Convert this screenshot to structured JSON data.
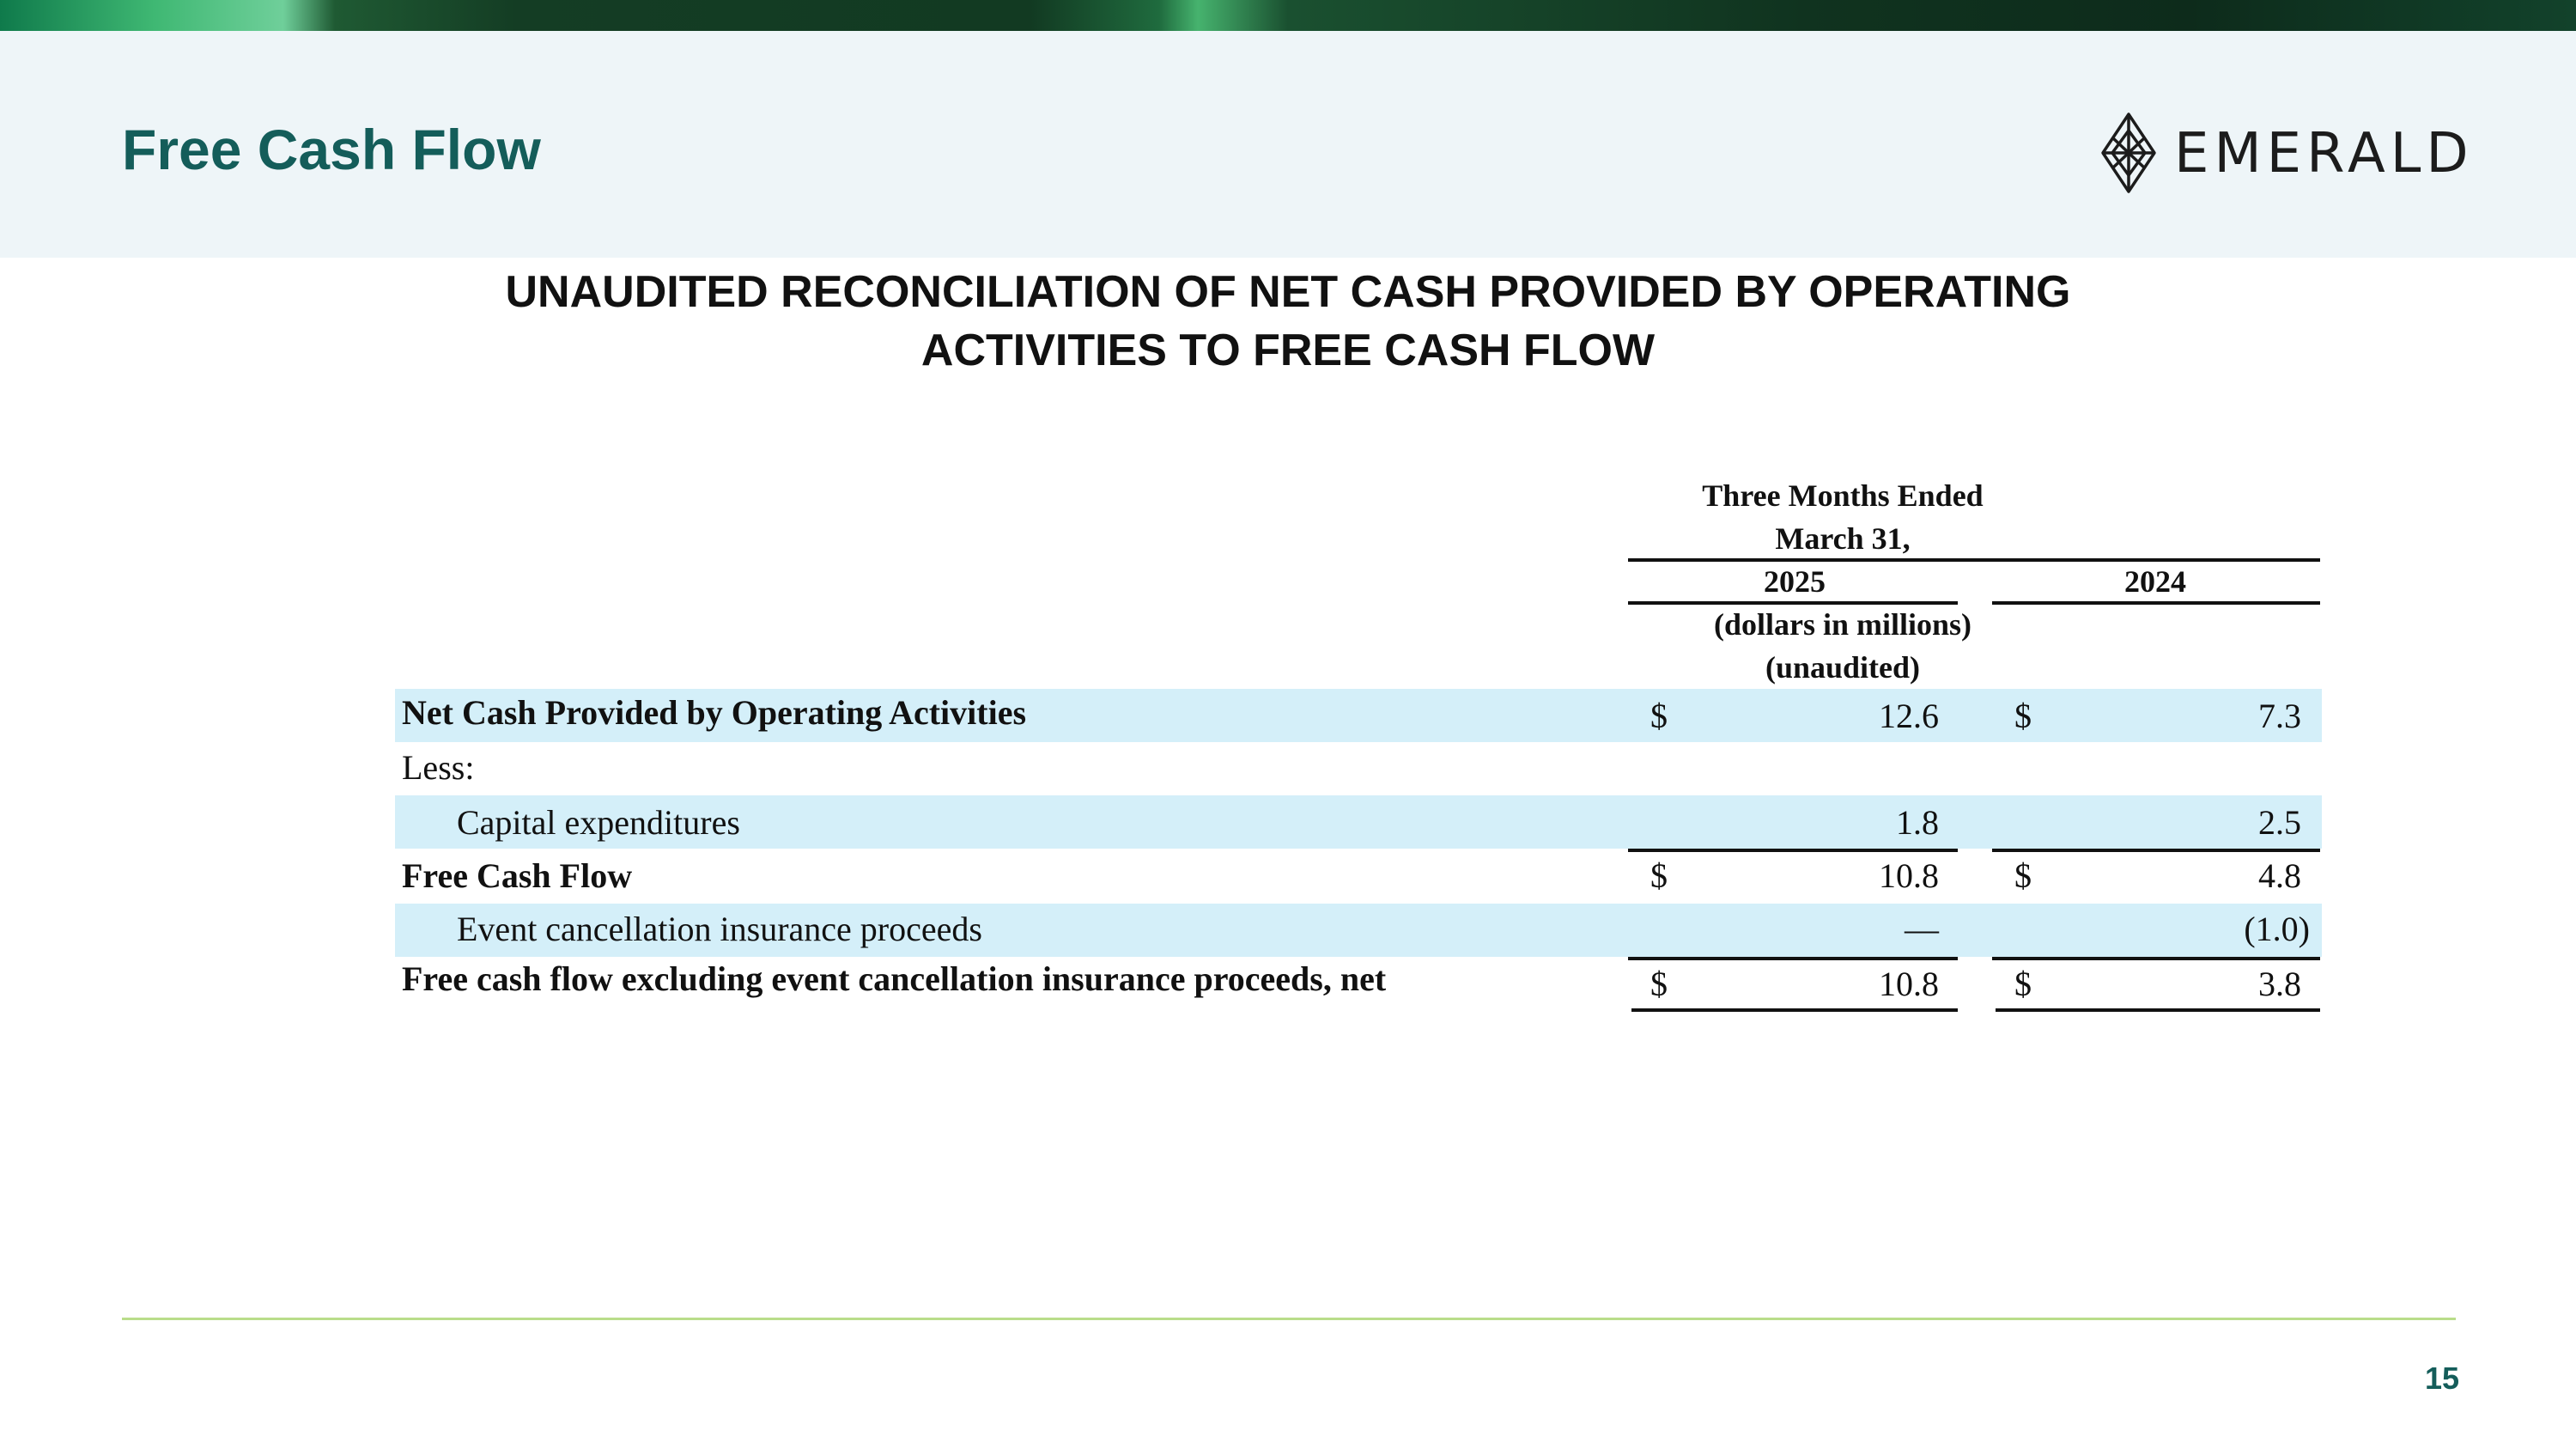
{
  "slide": {
    "title": "Free Cash Flow",
    "logo_text": "EMERALD",
    "page_number": "15"
  },
  "main": {
    "title_line1": "UNAUDITED RECONCILIATION OF NET CASH PROVIDED BY OPERATING",
    "title_line2": "ACTIVITIES TO FREE CASH FLOW"
  },
  "table": {
    "header_period_line1": "Three Months Ended",
    "header_period_line2": "March 31,",
    "col_2025": "2025",
    "col_2024": "2024",
    "units_line1": "(dollars in millions)",
    "units_line2": "(unaudited)",
    "rows": [
      {
        "label": "Net Cash Provided by Operating Activities",
        "bold": true,
        "dollar_2025": "$",
        "v2025": "12.6",
        "dollar_2024": "$",
        "v2024": "7.3"
      },
      {
        "label": "Less:",
        "bold": false,
        "dollar_2025": "",
        "v2025": "",
        "dollar_2024": "",
        "v2024": ""
      },
      {
        "label": "Capital expenditures",
        "bold": false,
        "dollar_2025": "",
        "v2025": "1.8",
        "dollar_2024": "",
        "v2024": "2.5"
      },
      {
        "label": "Free Cash Flow",
        "bold": true,
        "dollar_2025": "$",
        "v2025": "10.8",
        "dollar_2024": "$",
        "v2024": "4.8"
      },
      {
        "label": "Event cancellation insurance proceeds",
        "bold": false,
        "dollar_2025": "",
        "v2025": "—",
        "dollar_2024": "",
        "v2024": "(1.0)"
      },
      {
        "label": "Free cash flow excluding event cancellation insurance proceeds, net",
        "bold": true,
        "dollar_2025": "$",
        "v2025": "10.8",
        "dollar_2024": "$",
        "v2024": "3.8"
      }
    ]
  },
  "colors": {
    "title": "#145d5a",
    "band": "#d4eff9",
    "header_bg": "#eef5f8",
    "footer_rule": "#b9dd8a"
  }
}
